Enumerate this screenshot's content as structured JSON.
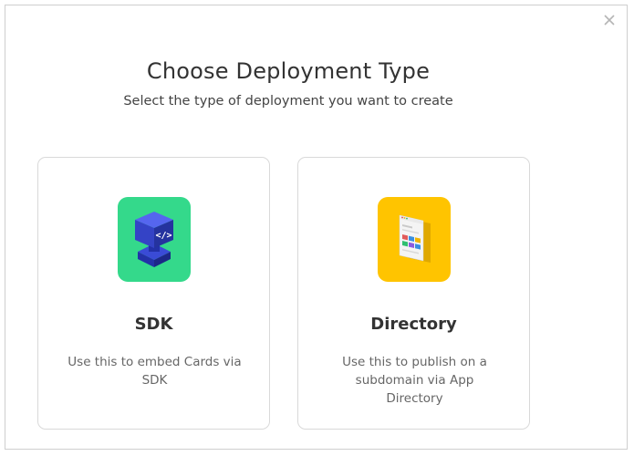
{
  "dialog": {
    "title": "Choose Deployment Type",
    "subtitle": "Select the type of deployment you want to create"
  },
  "options": [
    {
      "name": "SDK",
      "description": "Use this to embed Cards via SDK",
      "icon": "sdk-code-cube-icon",
      "tile_color": "#34d98b"
    },
    {
      "name": "Directory",
      "description": "Use this to publish on a subdomain via App Directory",
      "icon": "directory-page-icon",
      "tile_color": "#ffc400"
    }
  ],
  "icons": {
    "close": "close-icon"
  }
}
